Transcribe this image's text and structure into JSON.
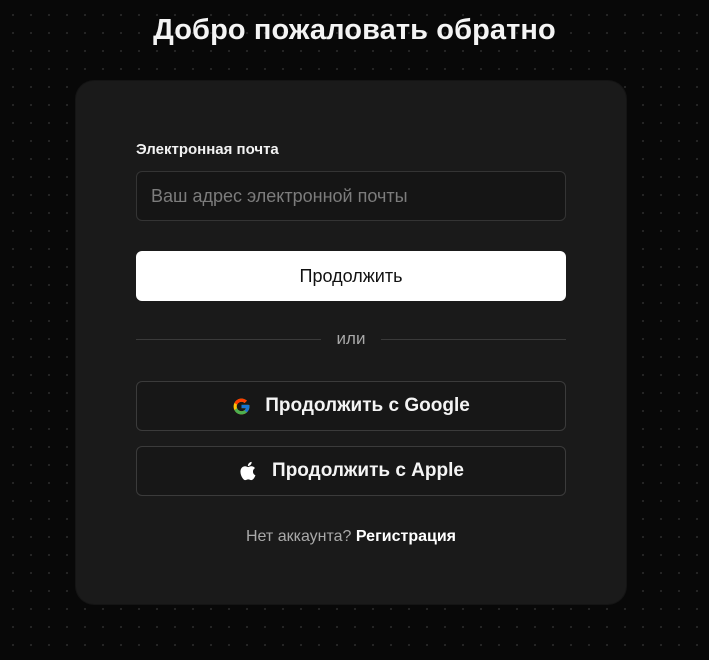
{
  "page": {
    "title": "Добро пожаловать обратно"
  },
  "form": {
    "email_label": "Электронная почта",
    "email_placeholder": "Ваш адрес электронной почты",
    "email_value": "",
    "continue_label": "Продолжить",
    "divider_text": "или",
    "google_label": "Продолжить с Google",
    "google_icon": "google-icon",
    "apple_label": "Продолжить с Apple",
    "apple_icon": "apple-icon"
  },
  "footer": {
    "no_account_text": "Нет аккаунта?",
    "signup_label": "Регистрация"
  },
  "colors": {
    "background": "#080808",
    "card": "#1a1a1a",
    "primary_button": "#ffffff",
    "border": "#3b3b3b"
  }
}
